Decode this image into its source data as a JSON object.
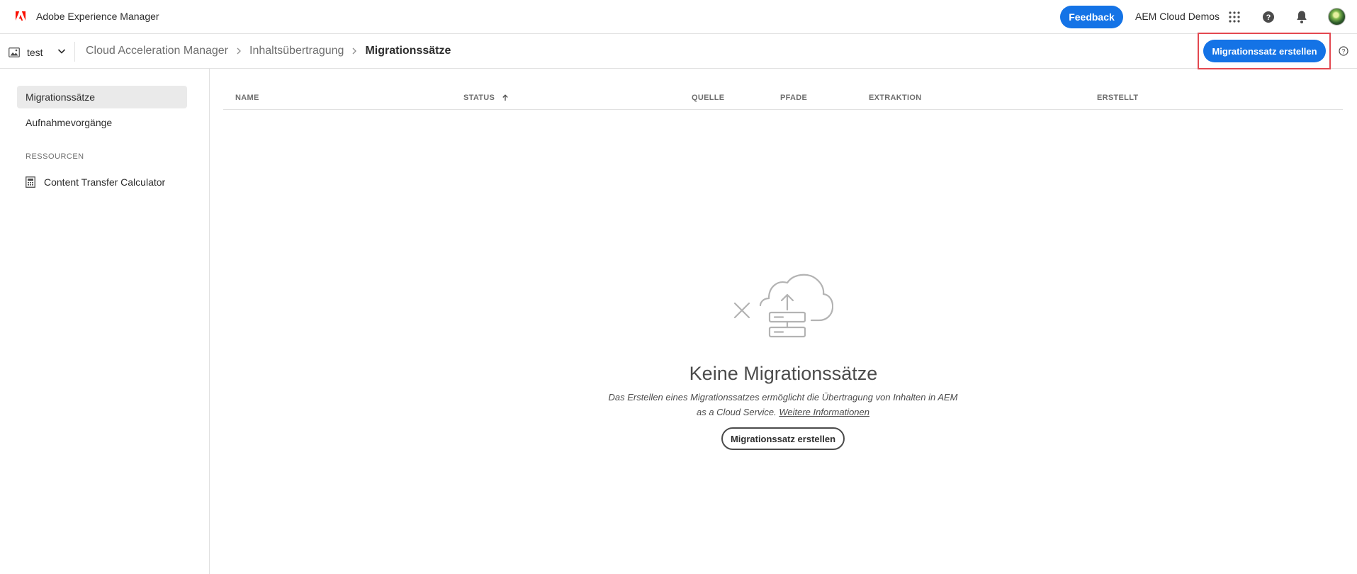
{
  "shell": {
    "app_title": "Adobe Experience Manager",
    "feedback_label": "Feedback",
    "org_name": "AEM Cloud Demos",
    "brand_color": "#fa0f00",
    "accent_color": "#1473e6"
  },
  "subheader": {
    "environment": "test",
    "breadcrumb": [
      "Cloud Acceleration Manager",
      "Inhaltsübertragung",
      "Migrationssätze"
    ],
    "create_button": "Migrationssatz erstellen"
  },
  "sidebar": {
    "items": [
      {
        "label": "Migrationssätze",
        "active": true
      },
      {
        "label": "Aufnahmevorgänge",
        "active": false
      }
    ],
    "section_title": "RESSOURCEN",
    "resources": [
      {
        "label": "Content Transfer Calculator",
        "icon": "calculator-icon"
      }
    ]
  },
  "table": {
    "columns": [
      "NAME",
      "STATUS",
      "QUELLE",
      "PFADE",
      "EXTRAKTION",
      "ERSTELLT"
    ],
    "sorted_column": "STATUS"
  },
  "empty_state": {
    "title": "Keine Migrationssätze",
    "description": "Das Erstellen eines Migrationssatzes ermöglicht die Übertragung von Inhalten in AEM as a Cloud Service.",
    "link": "Weitere Informationen",
    "button": "Migrationssatz erstellen"
  }
}
